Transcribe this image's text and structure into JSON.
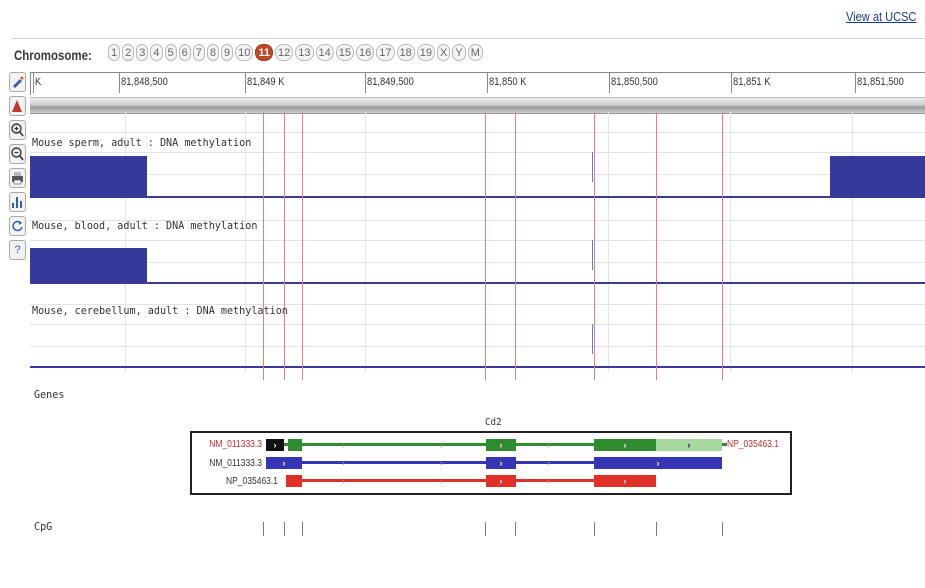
{
  "header": {
    "view_link": "View at UCSC"
  },
  "chromosome_bar": {
    "label": "Chromosome:",
    "chromosomes": [
      "1",
      "2",
      "3",
      "4",
      "5",
      "6",
      "7",
      "8",
      "9",
      "10",
      "11",
      "12",
      "13",
      "14",
      "15",
      "16",
      "17",
      "18",
      "19",
      "X",
      "Y",
      "M"
    ],
    "selected": "11"
  },
  "toolbar": {
    "icons": [
      "select-tool-icon",
      "feature-icon",
      "zoom-in-icon",
      "zoom-out-icon",
      "print-icon",
      "chart-icon",
      "refresh-icon",
      "help-icon"
    ],
    "help_glyph": "?"
  },
  "ruler": {
    "labels": [
      "K",
      "81,848,500",
      "81,849 K",
      "81,849,500",
      "81,850 K",
      "81,850,500",
      "81,851 K",
      "81,851,500"
    ]
  },
  "tracks": [
    {
      "label": "Mouse sperm, adult : DNA methylation"
    },
    {
      "label": "Mouse, blood, adult : DNA methylation"
    },
    {
      "label": "Mouse, cerebellum, adult : DNA methylation"
    }
  ],
  "genes": {
    "section_label": "Genes",
    "gene_symbol": "Cd2",
    "transcripts": [
      {
        "left_label": "NM_011333.3",
        "right_label": "NP_035463.1",
        "color": "#2e8b2e",
        "light_color": "#a8d8a0"
      },
      {
        "left_label": "NM_011333.3",
        "right_label": "",
        "color": "#3535b5"
      },
      {
        "left_label": "NP_035463.1",
        "right_label": "",
        "color": "#e0302a"
      }
    ]
  },
  "cpg": {
    "section_label": "CpG"
  },
  "colors": {
    "methylation": "#35399a",
    "marker_line": "#e08080",
    "selected_chrom": "#c0492c"
  }
}
